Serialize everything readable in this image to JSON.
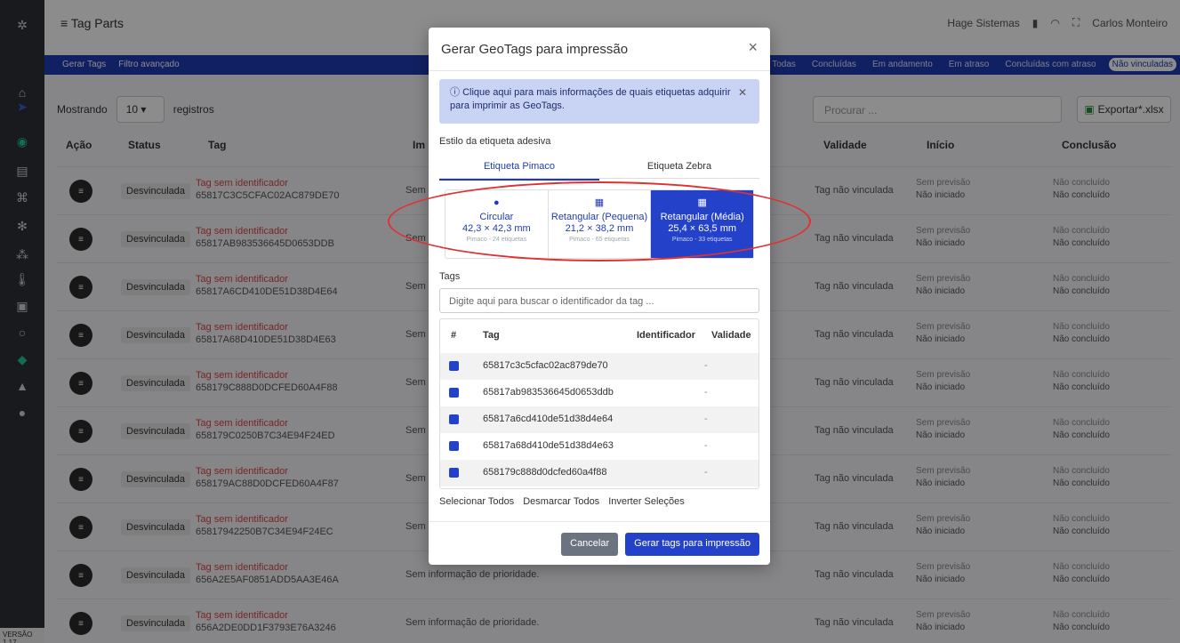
{
  "app": {
    "title": "Tag Parts",
    "company": "Hage Sistemas",
    "user": "Carlos Monteiro",
    "version": "VERSÃO 1.17"
  },
  "toolbar": {
    "gerar": "Gerar Tags",
    "filtro": "Filtro avançado"
  },
  "filters": [
    "Todas",
    "Concluídas",
    "Em andamento",
    "Em atraso",
    "Concluídas com atraso",
    "Não vinculadas"
  ],
  "list": {
    "mostrando": "Mostrando",
    "page_size": "10",
    "registros": "registros",
    "search_placeholder": "Procurar ...",
    "export": "Exportar*.xlsx",
    "columns": [
      "Ação",
      "Status",
      "Tag",
      "Im",
      "Validade",
      "Início",
      "Conclusão"
    ],
    "rows": [
      {
        "status": "Desvinculada",
        "tag_label": "Tag sem identificador",
        "tag_id": "65817C3C5CFAC02AC879DE70",
        "imp": "Sem i",
        "val": "Tag não vinculada",
        "ini1": "Sem previsão",
        "ini2": "Não iniciado",
        "con1": "Não concluído",
        "con2": "Não concluído"
      },
      {
        "status": "Desvinculada",
        "tag_label": "Tag sem identificador",
        "tag_id": "65817AB983536645D0653DDB",
        "imp": "Sem i",
        "val": "Tag não vinculada",
        "ini1": "Sem previsão",
        "ini2": "Não iniciado",
        "con1": "Não concluído",
        "con2": "Não concluído"
      },
      {
        "status": "Desvinculada",
        "tag_label": "Tag sem identificador",
        "tag_id": "65817A6CD410DE51D38D4E64",
        "imp": "Sem i",
        "val": "Tag não vinculada",
        "ini1": "Sem previsão",
        "ini2": "Não iniciado",
        "con1": "Não concluído",
        "con2": "Não concluído"
      },
      {
        "status": "Desvinculada",
        "tag_label": "Tag sem identificador",
        "tag_id": "65817A68D410DE51D38D4E63",
        "imp": "Sem i",
        "val": "Tag não vinculada",
        "ini1": "Sem previsão",
        "ini2": "Não iniciado",
        "con1": "Não concluído",
        "con2": "Não concluído"
      },
      {
        "status": "Desvinculada",
        "tag_label": "Tag sem identificador",
        "tag_id": "658179C888D0DCFED60A4F88",
        "imp": "Sem i",
        "val": "Tag não vinculada",
        "ini1": "Sem previsão",
        "ini2": "Não iniciado",
        "con1": "Não concluído",
        "con2": "Não concluído"
      },
      {
        "status": "Desvinculada",
        "tag_label": "Tag sem identificador",
        "tag_id": "658179C0250B7C34E94F24ED",
        "imp": "Sem i",
        "val": "Tag não vinculada",
        "ini1": "Sem previsão",
        "ini2": "Não iniciado",
        "con1": "Não concluído",
        "con2": "Não concluído"
      },
      {
        "status": "Desvinculada",
        "tag_label": "Tag sem identificador",
        "tag_id": "658179AC88D0DCFED60A4F87",
        "imp": "Sem i",
        "val": "Tag não vinculada",
        "ini1": "Sem previsão",
        "ini2": "Não iniciado",
        "con1": "Não concluído",
        "con2": "Não concluído"
      },
      {
        "status": "Desvinculada",
        "tag_label": "Tag sem identificador",
        "tag_id": "65817942250B7C34E94F24EC",
        "imp": "Sem i",
        "val": "Tag não vinculada",
        "ini1": "Sem previsão",
        "ini2": "Não iniciado",
        "con1": "Não concluído",
        "con2": "Não concluído"
      },
      {
        "status": "Desvinculada",
        "tag_label": "Tag sem identificador",
        "tag_id": "656A2E5AF0851ADD5AA3E46A",
        "imp": "Sem informação de prioridade.",
        "val": "Tag não vinculada",
        "ini1": "Sem previsão",
        "ini2": "Não iniciado",
        "con1": "Não concluído",
        "con2": "Não concluído"
      },
      {
        "status": "Desvinculada",
        "tag_label": "Tag sem identificador",
        "tag_id": "656A2DE0DD1F3793E76A3246",
        "imp": "Sem informação de prioridade.",
        "val": "Tag não vinculada",
        "ini1": "Sem previsão",
        "ini2": "Não iniciado",
        "con1": "Não concluído",
        "con2": "Não concluído"
      }
    ]
  },
  "modal": {
    "title": "Gerar GeoTags para impressão",
    "close": "×",
    "info": "Clique aqui para mais informações de quais etiquetas adquirir para imprimir as GeoTags.",
    "estilo_label": "Estilo da etiqueta adesiva",
    "tabs": [
      "Etiqueta Pimaco",
      "Etiqueta Zebra"
    ],
    "styles": [
      {
        "name": "Circular",
        "size": "42,3 × 42,3 mm",
        "sub": "Pimaco - 24 etiquetas"
      },
      {
        "name": "Retangular (Pequena)",
        "size": "21,2 × 38,2 mm",
        "sub": "Pimaco - 65 etiquetas"
      },
      {
        "name": "Retangular (Média)",
        "size": "25,4 × 63,5 mm",
        "sub": "Pimaco - 33 etiquetas"
      }
    ],
    "selected_style": "Retangular (Média)",
    "tags_label": "Tags",
    "search_placeholder": "Digite aqui para buscar o identificador da tag ...",
    "columns": [
      "#",
      "Tag",
      "Identificador",
      "Validade"
    ],
    "rows": [
      {
        "tag": "65817c3c5cfac02ac879de70",
        "val": "-"
      },
      {
        "tag": "65817ab983536645d0653ddb",
        "val": "-"
      },
      {
        "tag": "65817a6cd410de51d38d4e64",
        "val": "-"
      },
      {
        "tag": "65817a68d410de51d38d4e63",
        "val": "-"
      },
      {
        "tag": "658179c888d0dcfed60a4f88",
        "val": "-"
      }
    ],
    "actions": [
      "Selecionar Todos",
      "Desmarcar Todos",
      "Inverter Seleções"
    ],
    "cancel": "Cancelar",
    "submit": "Gerar tags para impressão"
  }
}
